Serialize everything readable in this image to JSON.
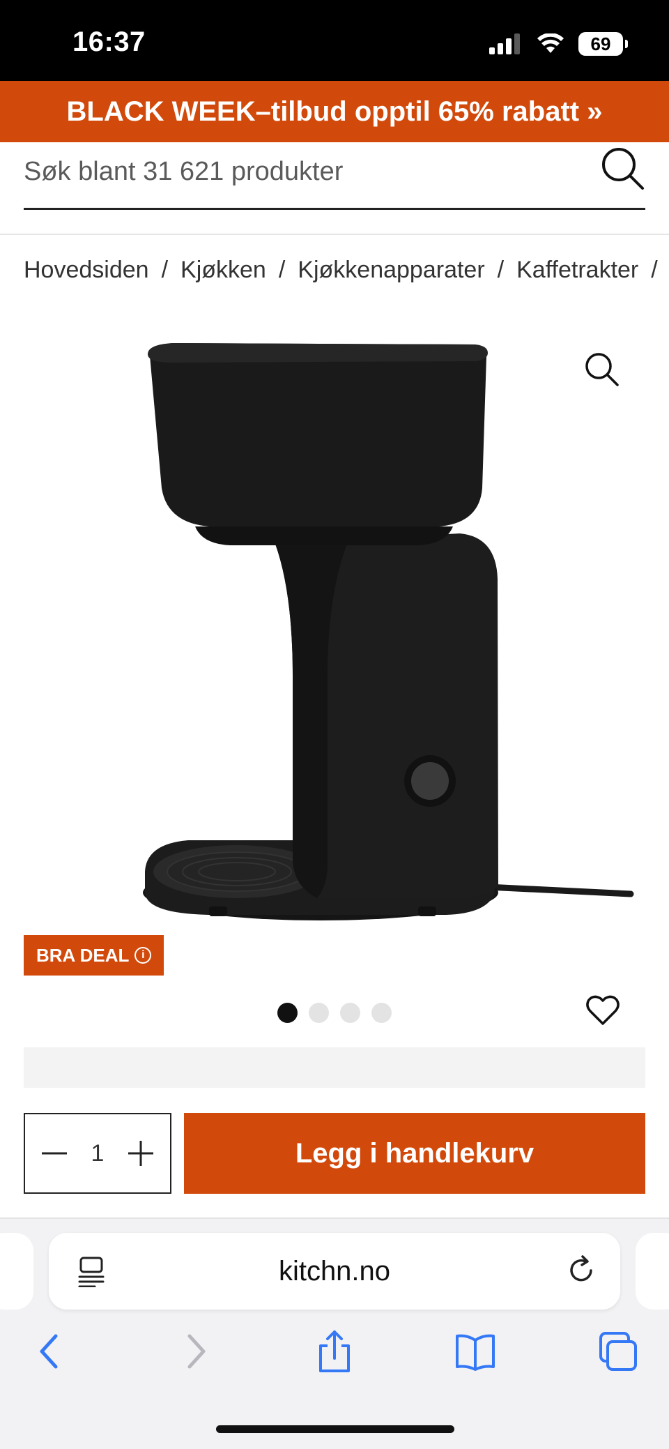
{
  "status_bar": {
    "time": "16:37",
    "battery": "69"
  },
  "promo": {
    "text": "BLACK WEEK–tilbud opptil 65% rabatt »"
  },
  "search": {
    "placeholder": "Søk blant 31 621 produkter"
  },
  "breadcrumb": [
    "Hovedsiden",
    "Kjøkken",
    "Kjøkkenapparater",
    "Kaffetrakter"
  ],
  "breadcrumb_separator": "/",
  "product": {
    "badge": "BRA DEAL",
    "image_count": 4,
    "active_image": 1
  },
  "cart": {
    "quantity": "1",
    "add_label": "Legg i handlekurv"
  },
  "browser": {
    "url": "kitchn.no"
  },
  "colors": {
    "brand": "#d24a0b",
    "text": "#222222",
    "link": "#3478f6"
  }
}
